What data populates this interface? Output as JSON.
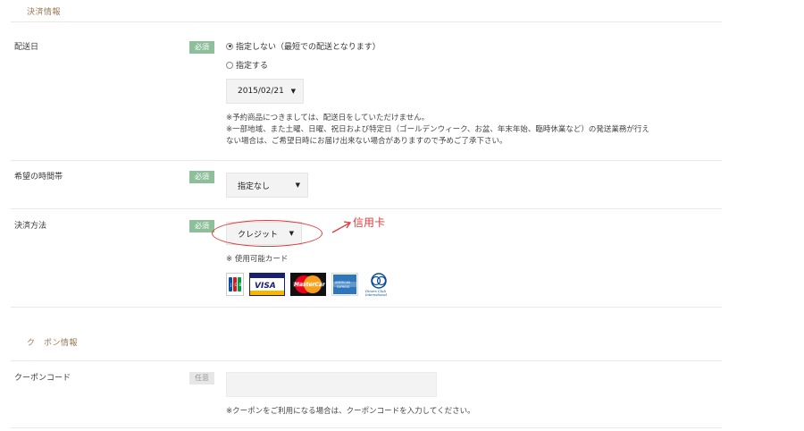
{
  "sections": {
    "payment_info_title": "決済情報",
    "coupon_info_title": "ク　ポン情報"
  },
  "delivery_date": {
    "label": "配送日",
    "badge": "必須",
    "option_unspecified": "指定しない（最短での配送となります）",
    "option_specify": "指定する",
    "selected_date": "2015/02/21",
    "note_line1": "※予約商品につきましては、配送日をしていただけません。",
    "note_line2": "※一部地域、また土曜、日曜、祝日および特定日（ゴールデンウィーク、お盆、年末年始、臨時休業など）の発送業務が行え",
    "note_line3": "ない場合は、ご希望日時にお届け出来ない場合がありますので予めご了承下さい。"
  },
  "delivery_time": {
    "label": "希望の時間帯",
    "badge": "必須",
    "selected": "指定なし"
  },
  "payment_method": {
    "label": "決済方法",
    "badge": "必須",
    "selected": "クレジット",
    "annotation": "信用卡",
    "cards_note": "※ 使用可能カード",
    "cards": [
      "JCB",
      "VISA",
      "MasterCard",
      "AMERICAN EXPRESS",
      "Diners Club International"
    ]
  },
  "coupon": {
    "label": "クーポンコード",
    "badge": "任意",
    "value": "",
    "note": "※クーポンをご利用になる場合は、クーポンコードを入力してください。"
  },
  "colors": {
    "required_badge": "#8dbf9a",
    "optional_badge": "#e7e7e7",
    "section_title": "#9a7a57",
    "annotation_red": "#e03a3a"
  }
}
